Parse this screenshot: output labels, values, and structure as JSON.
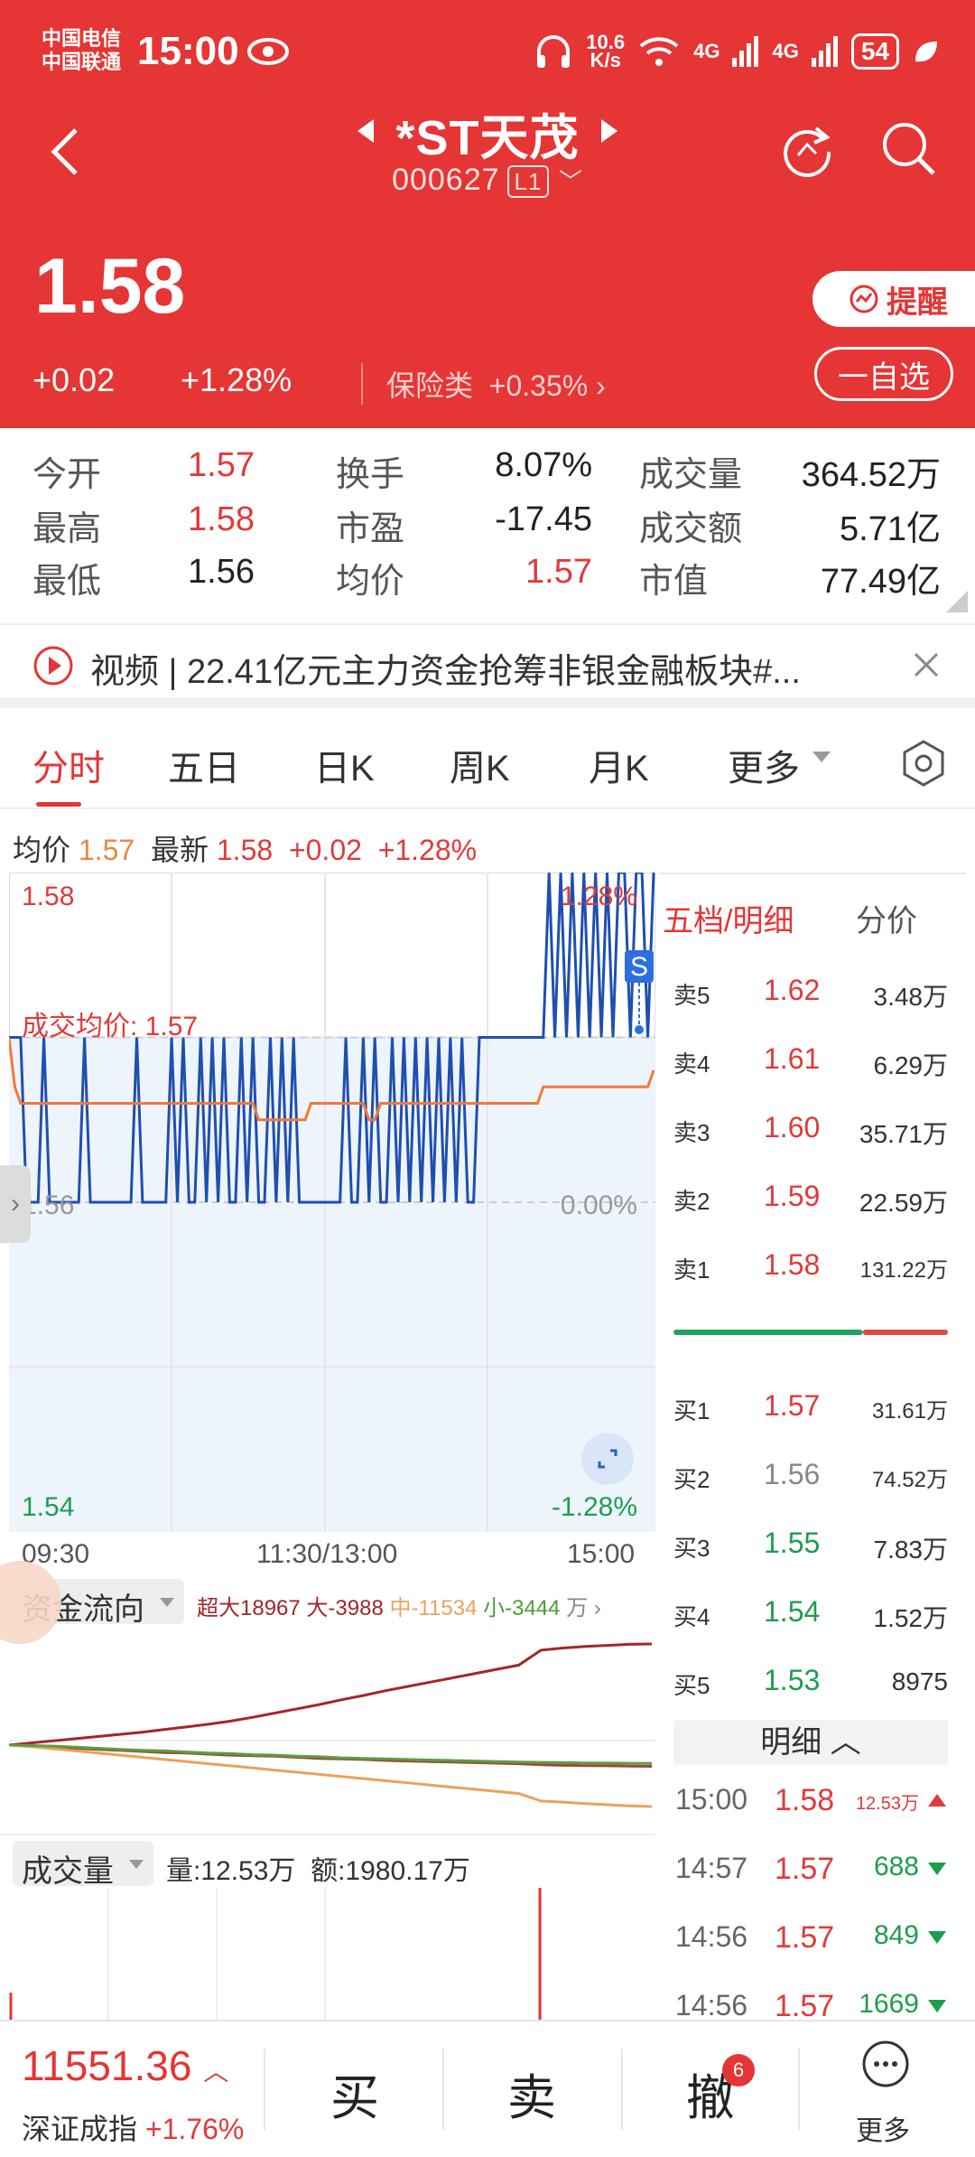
{
  "status_bar": {
    "carrier1": "中国电信",
    "carrier2": "中国联通",
    "time": "15:00",
    "speed_top": "10.6",
    "speed_bottom": "K/s",
    "net1": "4G",
    "net2": "4G",
    "battery": "54"
  },
  "stock": {
    "name": "*ST天茂",
    "code": "000627",
    "level": "L1",
    "price": "1.58",
    "change": "+0.02",
    "change_pct": "+1.28%",
    "sector": "保险类",
    "sector_pct": "+0.35%",
    "remind_label": "提醒",
    "self_label": "一自选"
  },
  "stats": [
    {
      "label": "今开",
      "value": "1.57",
      "color": "red"
    },
    {
      "label": "换手",
      "value": "8.07%",
      "color": "dark"
    },
    {
      "label": "成交量",
      "value": "364.52万",
      "color": "dark"
    },
    {
      "label": "最高",
      "value": "1.58",
      "color": "red"
    },
    {
      "label": "市盈",
      "value": "-17.45",
      "color": "dark"
    },
    {
      "label": "成交额",
      "value": "5.71亿",
      "color": "dark"
    },
    {
      "label": "最低",
      "value": "1.56",
      "color": "dark"
    },
    {
      "label": "均价",
      "value": "1.57",
      "color": "red"
    },
    {
      "label": "市值",
      "value": "77.49亿",
      "color": "dark"
    }
  ],
  "news": {
    "text": "视频 | 22.41亿元主力资金抢筹非银金融板块#..."
  },
  "tabs": [
    "分时",
    "五日",
    "日K",
    "周K",
    "月K",
    "更多"
  ],
  "legend": {
    "avg_label": "均价",
    "avg_value": "1.57",
    "latest_label": "最新",
    "latest_value": "1.58",
    "change": "+0.02",
    "change_pct": "+1.28%"
  },
  "chart_data": {
    "type": "line",
    "title": "",
    "y_labels": {
      "top": "1.58",
      "mid": "1.56",
      "bottom": "1.54",
      "top_pct": "1.28%",
      "mid_pct": "0.00%",
      "bottom_pct": "-1.28%"
    },
    "avg_annotation": "成交均价: 1.57",
    "x_labels": [
      "09:30",
      "11:30/13:00",
      "15:00"
    ],
    "ylim": [
      1.54,
      1.58
    ],
    "prev_close": 1.56,
    "marker": "S",
    "series": [
      {
        "values": [
          1.57,
          1.57,
          1.57,
          1.56,
          1.56,
          1.56,
          1.57,
          1.56,
          1.56,
          1.56,
          1.56,
          1.56,
          1.56,
          1.57,
          1.56,
          1.56,
          1.56,
          1.56,
          1.56,
          1.56,
          1.56,
          1.56,
          1.57,
          1.56,
          1.56,
          1.56,
          1.56,
          1.56,
          1.57,
          1.56,
          1.57,
          1.56,
          1.56,
          1.57,
          1.56,
          1.57,
          1.56,
          1.57,
          1.56,
          1.56,
          1.57,
          1.56,
          1.57,
          1.56,
          1.56,
          1.57,
          1.56,
          1.57,
          1.56,
          1.57,
          1.56,
          1.56,
          1.56,
          1.56,
          1.56,
          1.56,
          1.56,
          1.56,
          1.57,
          1.56,
          1.56,
          1.57,
          1.56,
          1.57,
          1.56,
          1.56,
          1.57,
          1.56,
          1.57,
          1.56,
          1.57,
          1.56,
          1.57,
          1.56,
          1.57,
          1.56,
          1.57,
          1.56,
          1.57,
          1.56,
          1.56,
          1.57,
          1.57,
          1.57,
          1.57,
          1.57,
          1.57,
          1.57,
          1.57,
          1.57,
          1.57,
          1.57,
          1.57,
          1.58,
          1.57,
          1.58,
          1.57,
          1.58,
          1.57,
          1.58,
          1.57,
          1.58,
          1.57,
          1.58,
          1.57,
          1.58,
          1.58,
          1.57,
          1.58,
          1.58,
          1.57,
          1.58
        ]
      },
      {
        "values": [
          1.57,
          1.567,
          1.566,
          1.566,
          1.566,
          1.566,
          1.566,
          1.566,
          1.566,
          1.566,
          1.566,
          1.566,
          1.566,
          1.566,
          1.566,
          1.566,
          1.566,
          1.566,
          1.566,
          1.566,
          1.566,
          1.566,
          1.566,
          1.566,
          1.566,
          1.566,
          1.566,
          1.566,
          1.566,
          1.566,
          1.566,
          1.566,
          1.566,
          1.566,
          1.566,
          1.566,
          1.566,
          1.566,
          1.566,
          1.566,
          1.566,
          1.566,
          1.566,
          1.565,
          1.565,
          1.565,
          1.565,
          1.565,
          1.565,
          1.565,
          1.565,
          1.565,
          1.566,
          1.566,
          1.566,
          1.566,
          1.566,
          1.566,
          1.566,
          1.566,
          1.566,
          1.566,
          1.565,
          1.565,
          1.566,
          1.566,
          1.566,
          1.566,
          1.566,
          1.566,
          1.566,
          1.566,
          1.566,
          1.566,
          1.566,
          1.566,
          1.566,
          1.566,
          1.566,
          1.566,
          1.566,
          1.566,
          1.566,
          1.566,
          1.566,
          1.566,
          1.566,
          1.566,
          1.566,
          1.566,
          1.566,
          1.566,
          1.567,
          1.567,
          1.567,
          1.567,
          1.567,
          1.567,
          1.567,
          1.567,
          1.567,
          1.567,
          1.567,
          1.567,
          1.567,
          1.567,
          1.567,
          1.567,
          1.567,
          1.567,
          1.567,
          1.568
        ]
      }
    ]
  },
  "fund_flow": {
    "title": "资金流向",
    "super": "超大18967",
    "big": "大-3988",
    "mid": "中-11534",
    "small": "小-3444",
    "unit": "万",
    "series": [
      {
        "values": [
          0,
          400,
          800,
          1200,
          1600,
          2000,
          2400,
          2900,
          3400,
          3900,
          4500,
          5200,
          6000,
          6800,
          7600,
          8500,
          9300,
          10200,
          11000,
          11800,
          12600,
          13400,
          14200,
          15000,
          17800,
          18200,
          18500,
          18700,
          18900,
          18967
        ]
      },
      {
        "values": [
          0,
          -200,
          -400,
          -600,
          -800,
          -1000,
          -1200,
          -1400,
          -1500,
          -1700,
          -1900,
          -2000,
          -2100,
          -2300,
          -2500,
          -2600,
          -2700,
          -2900,
          -3000,
          -3100,
          -3200,
          -3300,
          -3400,
          -3500,
          -3700,
          -3800,
          -3850,
          -3900,
          -3950,
          -3988
        ]
      },
      {
        "values": [
          0,
          -300,
          -700,
          -1100,
          -1500,
          -1900,
          -2300,
          -2700,
          -3100,
          -3500,
          -3900,
          -4300,
          -4700,
          -5100,
          -5500,
          -5900,
          -6300,
          -6700,
          -7100,
          -7500,
          -7900,
          -8300,
          -8700,
          -9100,
          -10500,
          -10700,
          -11000,
          -11200,
          -11400,
          -11534
        ]
      },
      {
        "values": [
          0,
          -100,
          -200,
          -400,
          -600,
          -800,
          -1000,
          -1100,
          -1300,
          -1500,
          -1600,
          -1800,
          -1900,
          -2100,
          -2200,
          -2400,
          -2500,
          -2600,
          -2700,
          -2800,
          -2900,
          -3000,
          -3100,
          -3200,
          -3250,
          -3300,
          -3350,
          -3380,
          -3420,
          -3444
        ]
      }
    ]
  },
  "volume": {
    "title": "成交量",
    "vol": "量:12.53万",
    "amount": "额:1980.17万"
  },
  "orderbook": {
    "header": "五档/明细",
    "header2": "分价",
    "asks": [
      {
        "label": "卖5",
        "price": "1.62",
        "vol": "3.48万"
      },
      {
        "label": "卖4",
        "price": "1.61",
        "vol": "6.29万"
      },
      {
        "label": "卖3",
        "price": "1.60",
        "vol": "35.71万"
      },
      {
        "label": "卖2",
        "price": "1.59",
        "vol": "22.59万"
      },
      {
        "label": "卖1",
        "price": "1.58",
        "vol": "131.22万"
      }
    ],
    "bids": [
      {
        "label": "买1",
        "price": "1.57",
        "vol": "31.61万"
      },
      {
        "label": "买2",
        "price": "1.56",
        "vol": "74.52万"
      },
      {
        "label": "买3",
        "price": "1.55",
        "vol": "7.83万"
      },
      {
        "label": "买4",
        "price": "1.54",
        "vol": "1.52万"
      },
      {
        "label": "买5",
        "price": "1.53",
        "vol": "8975"
      }
    ],
    "buy_ratio": 0.69,
    "detail_label": "明细",
    "details": [
      {
        "time": "15:00",
        "price": "1.58",
        "vol": "12.53万",
        "dir": "up"
      },
      {
        "time": "14:57",
        "price": "1.57",
        "vol": "688",
        "dir": "down"
      },
      {
        "time": "14:56",
        "price": "1.57",
        "vol": "849",
        "dir": "down"
      },
      {
        "time": "14:56",
        "price": "1.57",
        "vol": "1669",
        "dir": "down"
      }
    ]
  },
  "bottom": {
    "index_value": "11551.36",
    "index_name": "深证成指",
    "index_pct": "+1.76%",
    "buy": "买",
    "sell": "卖",
    "cancel": "撤",
    "cancel_badge": "6",
    "more": "更多"
  },
  "colors": {
    "header_red": "#e53535",
    "price_line": "#1f4fb0",
    "avg_line": "#f07a3a",
    "green": "#1e9d4e"
  }
}
